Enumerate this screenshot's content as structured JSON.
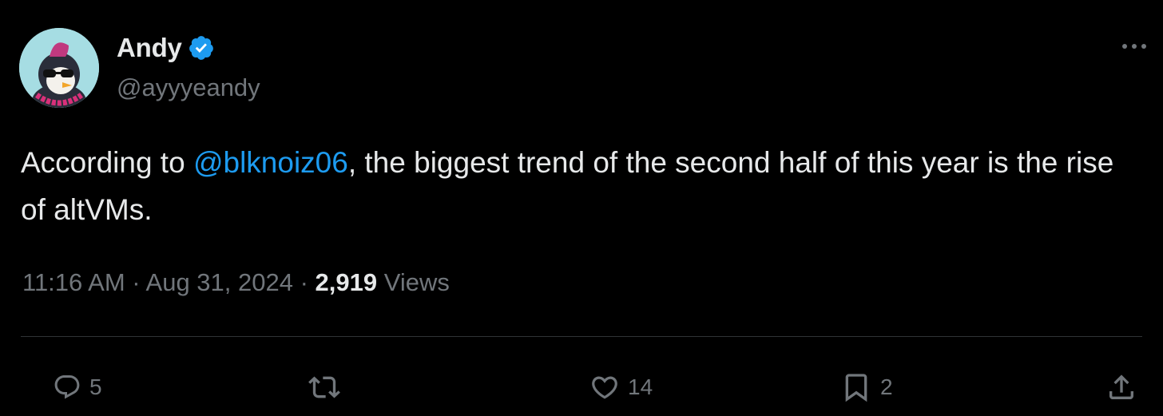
{
  "author": {
    "display_name": "Andy",
    "handle": "@ayyyeandy"
  },
  "tweet": {
    "text_before": "According to ",
    "mention": "@blknoiz06",
    "text_after": ", the biggest trend of the second half of this year is the rise of altVMs."
  },
  "meta": {
    "time": "11:16 AM",
    "separator1": " · ",
    "date": "Aug 31, 2024",
    "separator2": " · ",
    "views_count": "2,919",
    "views_label": " Views"
  },
  "actions": {
    "replies": "5",
    "likes": "14",
    "bookmarks": "2"
  },
  "icons": {
    "verified": "verified-badge-icon",
    "more": "more-horizontal-icon",
    "reply": "reply-icon",
    "retweet": "retweet-icon",
    "like": "heart-icon",
    "bookmark": "bookmark-icon",
    "share": "share-icon"
  },
  "colors": {
    "background": "#000000",
    "text": "#e7e9ea",
    "secondary": "#71767b",
    "accent": "#1d9bf0",
    "divider": "#2f3336"
  }
}
